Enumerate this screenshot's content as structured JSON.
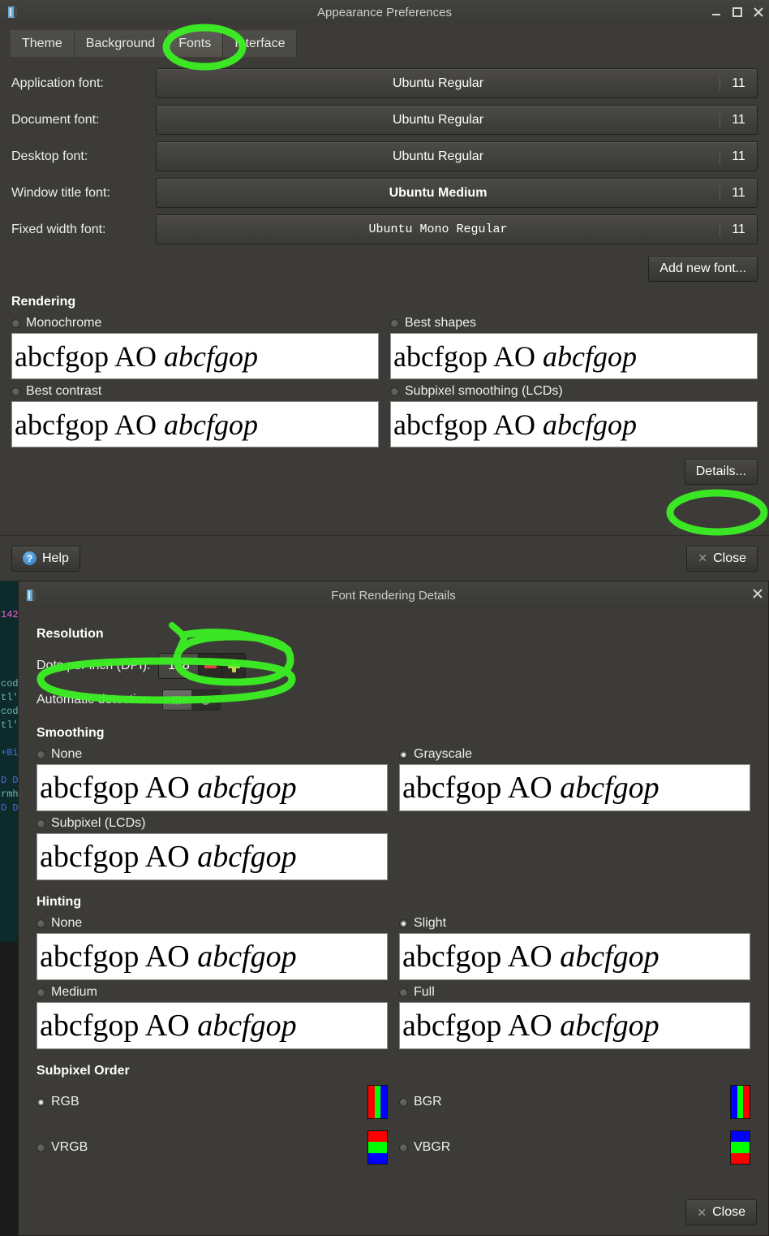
{
  "terminal": {
    "lines": [
      {
        "text": "",
        "color": "#0d2b2b"
      },
      {
        "text": "",
        "color": "#0d2b2b"
      },
      {
        "text": "142",
        "color": "#ff5fd7"
      },
      {
        "text": "",
        "color": "#0d2b2b"
      },
      {
        "text": "",
        "color": "#0d2b2b"
      },
      {
        "text": "",
        "color": "#0d2b2b"
      },
      {
        "text": "",
        "color": "#0d2b2b"
      },
      {
        "text": "cod",
        "color": "#6fb9b0"
      },
      {
        "text": "tl'",
        "color": "#6fb9b0"
      },
      {
        "text": "cod",
        "color": "#6fb9b0"
      },
      {
        "text": "tl'",
        "color": "#6fb9b0"
      },
      {
        "text": "",
        "color": "#0d2b2b"
      },
      {
        "text": "+Bi",
        "color": "#4a6fe0"
      },
      {
        "text": "",
        "color": "#0d2b2b"
      },
      {
        "text": "D D",
        "color": "#4a6fe0"
      },
      {
        "text": "rmh",
        "color": "#6fb9b0"
      },
      {
        "text": "D D",
        "color": "#4a6fe0"
      }
    ]
  },
  "appearance": {
    "title": "Appearance Preferences",
    "window_buttons": {
      "minimize": "minimize-icon",
      "maximize": "maximize-icon",
      "close": "close-icon"
    },
    "tabs": [
      {
        "label": "Theme",
        "active": false
      },
      {
        "label": "Background",
        "active": false
      },
      {
        "label": "Fonts",
        "active": true
      },
      {
        "label": "Interface",
        "active": false
      }
    ],
    "font_rows": [
      {
        "label": "Application font:",
        "font": "Ubuntu Regular",
        "size": "11",
        "style": "regular"
      },
      {
        "label": "Document font:",
        "font": "Ubuntu Regular",
        "size": "11",
        "style": "regular"
      },
      {
        "label": "Desktop font:",
        "font": "Ubuntu Regular",
        "size": "11",
        "style": "regular"
      },
      {
        "label": "Window title font:",
        "font": "Ubuntu Medium",
        "size": "11",
        "style": "medium"
      },
      {
        "label": "Fixed width font:",
        "font": "Ubuntu Mono Regular",
        "size": "11",
        "style": "mono"
      }
    ],
    "add_new_font_label": "Add new font...",
    "rendering": {
      "heading": "Rendering",
      "options": [
        {
          "label": "Monochrome",
          "selected": false,
          "sample": "abcfgop AO ",
          "sample_italic": "abcfgop"
        },
        {
          "label": "Best shapes",
          "selected": false,
          "sample": "abcfgop AO ",
          "sample_italic": "abcfgop"
        },
        {
          "label": "Best contrast",
          "selected": false,
          "sample": "abcfgop AO ",
          "sample_italic": "abcfgop"
        },
        {
          "label": "Subpixel smoothing (LCDs)",
          "selected": false,
          "sample": "abcfgop AO ",
          "sample_italic": "abcfgop"
        }
      ]
    },
    "details_label": "Details...",
    "help_label": "Help",
    "close_label": "Close"
  },
  "details": {
    "title": "Font Rendering Details",
    "close_icon": "close-icon",
    "resolution": {
      "heading": "Resolution",
      "dpi_label": "Dots per inch (DPI):",
      "dpi_value": "128",
      "minus_icon": "minus-icon",
      "plus_icon": "plus-icon",
      "auto_label": "Automatic detection:",
      "auto_state": "off"
    },
    "smoothing": {
      "heading": "Smoothing",
      "options": [
        {
          "label": "None",
          "selected": false,
          "sample": "abcfgop AO ",
          "sample_italic": "abcfgop"
        },
        {
          "label": "Grayscale",
          "selected": true,
          "sample": "abcfgop AO ",
          "sample_italic": "abcfgop"
        },
        {
          "label": "Subpixel (LCDs)",
          "selected": false,
          "sample": "abcfgop AO ",
          "sample_italic": "abcfgop"
        }
      ]
    },
    "hinting": {
      "heading": "Hinting",
      "options": [
        {
          "label": "None",
          "selected": false,
          "sample": "abcfgop AO ",
          "sample_italic": "abcfgop"
        },
        {
          "label": "Slight",
          "selected": true,
          "sample": "abcfgop AO ",
          "sample_italic": "abcfgop"
        },
        {
          "label": "Medium",
          "selected": false,
          "sample": "abcfgop AO ",
          "sample_italic": "abcfgop"
        },
        {
          "label": "Full",
          "selected": false,
          "sample": "abcfgop AO ",
          "sample_italic": "abcfgop"
        }
      ]
    },
    "subpixel_order": {
      "heading": "Subpixel Order",
      "options": [
        {
          "label": "RGB",
          "selected": true,
          "orientation": "vert",
          "colors": [
            "#ff0000",
            "#00ff00",
            "#0000ff"
          ]
        },
        {
          "label": "BGR",
          "selected": false,
          "orientation": "vert",
          "colors": [
            "#0000ff",
            "#00ff00",
            "#ff0000"
          ]
        },
        {
          "label": "VRGB",
          "selected": false,
          "orientation": "horz",
          "colors": [
            "#ff0000",
            "#00ff00",
            "#0000ff"
          ]
        },
        {
          "label": "VBGR",
          "selected": false,
          "orientation": "horz",
          "colors": [
            "#0000ff",
            "#00ff00",
            "#ff0000"
          ]
        }
      ]
    },
    "close_label": "Close"
  },
  "annotations": {
    "color": "#3bf023",
    "marks": [
      "fonts-tab-circle",
      "details-button-circle",
      "dpi-spinner-circle-arrow",
      "automatic-detection-circle"
    ]
  }
}
